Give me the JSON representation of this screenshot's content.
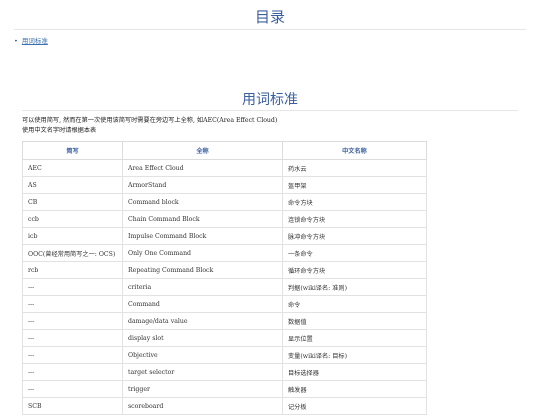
{
  "toc": {
    "title": "目录",
    "items": [
      {
        "label": "用词标准"
      }
    ]
  },
  "section": {
    "title": "用词标准",
    "intro_line1": "可以使用简写, 然而在第一次使用该简写时需要在旁边写上全称, 如AEC(Area Effect Cloud)",
    "intro_line2": "使用中文名字时请根据本表"
  },
  "table": {
    "headers": [
      "简写",
      "全称",
      "中文名称"
    ],
    "rows": [
      [
        "AEC",
        "Area Effect Cloud",
        "药水云"
      ],
      [
        "AS",
        "ArmorStand",
        "盔甲架"
      ],
      [
        "CB",
        "Command block",
        "命令方块"
      ],
      [
        "ccb",
        "Chain Command Block",
        "连锁命令方块"
      ],
      [
        "icb",
        "Impulse Command Block",
        "脉冲命令方块"
      ],
      [
        "OOC(曾经常用简写之一: OCS)",
        "Only One Command",
        "一条命令"
      ],
      [
        "rcb",
        "Repeating Command Block",
        "循环命令方块"
      ],
      [
        "---",
        "criteria",
        "判据(wiki译名: 准则)"
      ],
      [
        "---",
        "Command",
        "命令"
      ],
      [
        "---",
        "damage/data value",
        "数据值"
      ],
      [
        "---",
        "display slot",
        "显示位置"
      ],
      [
        "---",
        "Objective",
        "变量(wiki译名: 目标)"
      ],
      [
        "---",
        "target selector",
        "目标选择器"
      ],
      [
        "---",
        "trigger",
        "触发器"
      ],
      [
        "SCB",
        "scoreboard",
        "记分板"
      ]
    ]
  }
}
